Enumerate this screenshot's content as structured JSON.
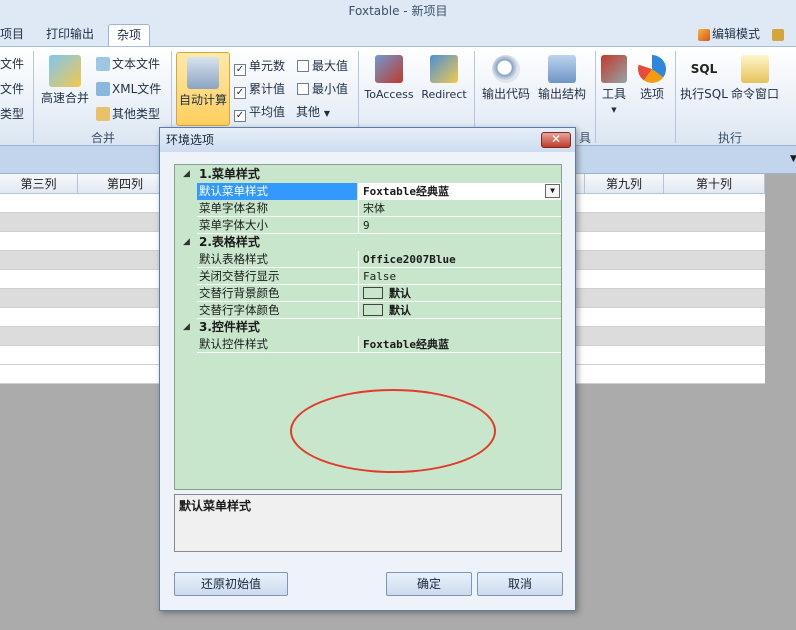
{
  "window": {
    "title": "Foxtable - 新项目"
  },
  "tabs": [
    {
      "label": "项目"
    },
    {
      "label": "打印输出"
    },
    {
      "label": "杂项"
    }
  ],
  "tabs_right": {
    "edit_mode": "编辑模式"
  },
  "ribbon": {
    "left_partial": [
      "文件",
      "文件",
      "类型"
    ],
    "merge_group": {
      "label": "合并",
      "quick_merge": "高速合并",
      "text_file": "文本文件",
      "xml_file": "XML文件",
      "other_types": "其他类型"
    },
    "calc_group": {
      "auto_calc": "自动计算",
      "cell_count": "单元数",
      "max": "最大值",
      "cumulative": "累计值",
      "min": "最小值",
      "average": "平均值",
      "other": "其他"
    },
    "tools_group": {
      "label": "具",
      "to_access": "ToAccess",
      "redirect": "Redirect",
      "export_code": "输出代码",
      "export_structure": "输出结构",
      "tools": "工具",
      "options": "选项"
    },
    "exec_group": {
      "label": "执行",
      "exec_sql": "执行SQL",
      "command_window": "命令窗口"
    }
  },
  "grid": {
    "columns": [
      "第三列",
      "第四列",
      "第九列",
      "第十列"
    ]
  },
  "dialog": {
    "title": "环境选项",
    "close": "✕",
    "categories": [
      {
        "label": "1.菜单样式",
        "rows": [
          {
            "name": "默认菜单样式",
            "value": "Foxtable经典蓝"
          },
          {
            "name": "菜单字体名称",
            "value": "宋体"
          },
          {
            "name": "菜单字体大小",
            "value": "9"
          }
        ]
      },
      {
        "label": "2.表格样式",
        "rows": [
          {
            "name": "默认表格样式",
            "value": "Office2007Blue"
          },
          {
            "name": "关闭交替行显示",
            "value": "False"
          },
          {
            "name": "交替行背景颜色",
            "value": "默认"
          },
          {
            "name": "交替行字体颜色",
            "value": "默认"
          }
        ]
      },
      {
        "label": "3.控件样式",
        "rows": [
          {
            "name": "默认控件样式",
            "value": "Foxtable经典蓝"
          }
        ]
      }
    ],
    "description": "默认菜单样式",
    "buttons": {
      "restore": "还原初始值",
      "ok": "确定",
      "cancel": "取消"
    }
  },
  "colors": {
    "property_grid_bg": "#c8e6cc",
    "selected_row": "#3399ff",
    "annotation": "#e33a2a"
  }
}
